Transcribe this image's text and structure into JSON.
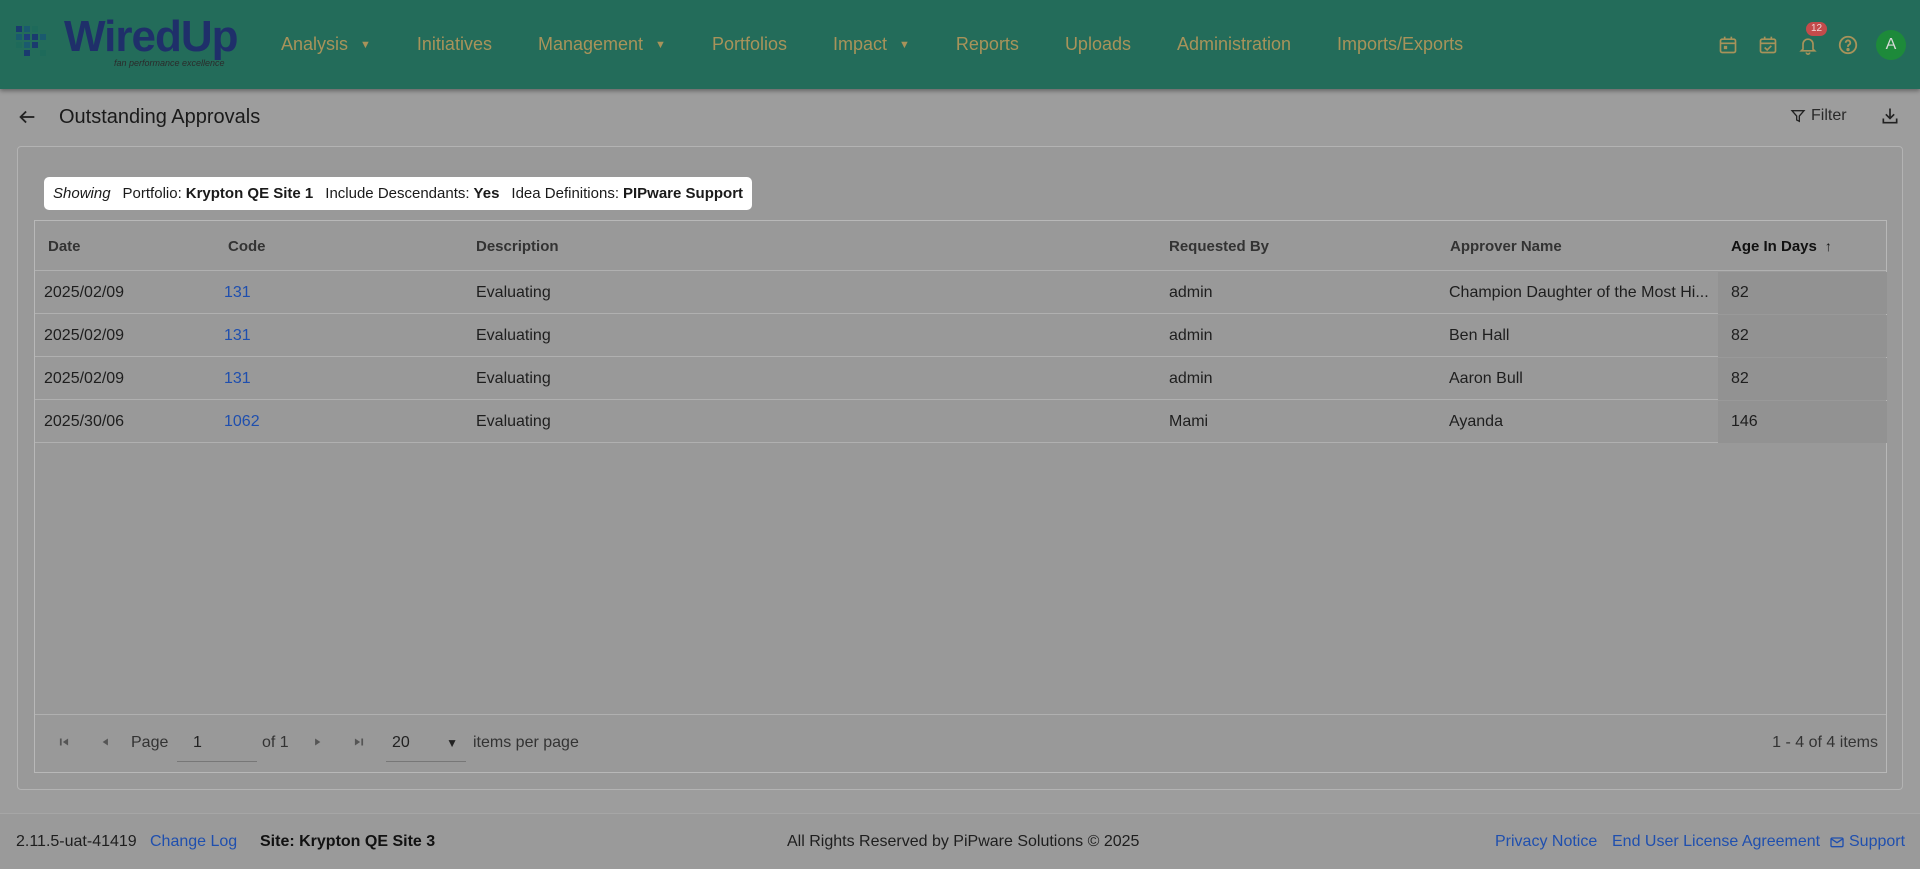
{
  "brand": {
    "name": "WiredUp",
    "tagline": "fan performance excellence",
    "mini": ""
  },
  "nav": {
    "items": [
      {
        "label": "Analysis",
        "dropdown": true
      },
      {
        "label": "Initiatives",
        "dropdown": false
      },
      {
        "label": "Management",
        "dropdown": true
      },
      {
        "label": "Portfolios",
        "dropdown": false
      },
      {
        "label": "Impact",
        "dropdown": true
      },
      {
        "label": "Reports",
        "dropdown": false
      },
      {
        "label": "Uploads",
        "dropdown": false
      },
      {
        "label": "Administration",
        "dropdown": false
      },
      {
        "label": "Imports/Exports",
        "dropdown": false
      }
    ],
    "notification_count": "12",
    "avatar_initial": "A"
  },
  "page": {
    "title": "Outstanding Approvals",
    "filter_label": "Filter"
  },
  "showing": {
    "label": "Showing",
    "portfolio_key": "Portfolio:",
    "portfolio_value": "Krypton QE Site 1",
    "descendants_key": "Include Descendants:",
    "descendants_value": "Yes",
    "idea_key": "Idea Definitions:",
    "idea_value": "PIPware Support"
  },
  "table": {
    "columns": [
      "Date",
      "Code",
      "Description",
      "Requested By",
      "Approver Name",
      "Age In Days"
    ],
    "sorted_column": "Age In Days",
    "rows": [
      {
        "date": "2025/02/09",
        "code": "131",
        "description": "Evaluating",
        "requested_by": "admin",
        "approver": "Champion Daughter of the Most Hi...",
        "age": "82"
      },
      {
        "date": "2025/02/09",
        "code": "131",
        "description": "Evaluating",
        "requested_by": "admin",
        "approver": "Ben Hall",
        "age": "82"
      },
      {
        "date": "2025/02/09",
        "code": "131",
        "description": "Evaluating",
        "requested_by": "admin",
        "approver": "Aaron Bull",
        "age": "82"
      },
      {
        "date": "2025/30/06",
        "code": "1062",
        "description": "Evaluating",
        "requested_by": "Mami",
        "approver": "Ayanda",
        "age": "146"
      }
    ]
  },
  "pager": {
    "page_label": "Page",
    "page_value": "1",
    "of_label": "of 1",
    "per_page_value": "20",
    "per_page_label": "items per page",
    "summary": "1 - 4 of 4 items"
  },
  "footer": {
    "version": "2.11.5-uat-41419",
    "changelog": "Change Log",
    "site": "Site: Krypton QE Site 3",
    "copyright": "All Rights Reserved by PiPware Solutions © 2025",
    "privacy": "Privacy Notice",
    "eula": "End User License Agreement",
    "support": "Support"
  },
  "colors": {
    "topbar": "#236c5a",
    "nav_text": "#a8935a",
    "link": "#1f4fae",
    "badge": "#c44b4b",
    "avatar": "#1d8a3a"
  },
  "icons": [
    "calendar-icon",
    "calendar-check-icon",
    "bell-icon",
    "help-icon",
    "back-arrow-icon",
    "filter-icon",
    "download-icon",
    "sort-up-icon",
    "first-page-icon",
    "prev-page-icon",
    "next-page-icon",
    "last-page-icon",
    "support-mail-icon"
  ]
}
